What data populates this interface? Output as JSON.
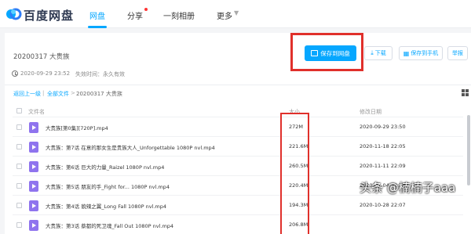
{
  "brand": {
    "name": "百度网盘"
  },
  "nav": {
    "items": [
      "网盘",
      "分享",
      "一刻相册",
      "更多"
    ]
  },
  "share": {
    "folder_title": "20200317 大贵族",
    "created": "2020-09-29 23:52",
    "expiry": "失效时间：永久有效"
  },
  "toolbar": {
    "save_label": "保存到网盘",
    "download_label": "下载",
    "save_phone_label": "保存到手机",
    "report_label": "举报"
  },
  "breadcrumb": {
    "back": "返回上一级",
    "sep": "|",
    "all_files": "全部文件",
    "arrow": ">",
    "current": "20200317 大贵族"
  },
  "table": {
    "headers": {
      "name": "文件名",
      "size": "大小",
      "date": "修改日期"
    },
    "rows": [
      {
        "name": "大贵族[第0集][720P].mp4",
        "size": "272M",
        "date": "2020-09-29 23:50"
      },
      {
        "name": "大贵族：第7话 在意的那女生是贵族大人_Unforgettable 1080P nvl.mp4",
        "size": "221.6M",
        "date": "2020-11-18 22:05"
      },
      {
        "name": "大贵族：第6话 巨大的力量_Raizel 1080P nvl.mp4",
        "size": "260.5M",
        "date": "2020-11-11 22:09"
      },
      {
        "name": "大贵族：第5话 朋友的手_Fight for...   1080P nvl.mp4",
        "size": "220.4M",
        "date": "2020-11-04 23:39"
      },
      {
        "name": "大贵族：第4话 貌辣之翼_Long Fall 1080P nvl.mp4",
        "size": "194.3M",
        "date": "2020-10-28 22:07"
      },
      {
        "name": "大贵族：第3话 蔡都的死卫魂_Fall Out 1080P nvl.mp4",
        "size": "206.8M",
        "date": ""
      }
    ]
  },
  "watermark": "头条 @楠楠子aaa",
  "colors": {
    "accent": "#06a7ff",
    "highlight": "#e0302b",
    "video_icon": "#8f74ee"
  },
  "icons": [
    "baidu-logo-icon",
    "save-icon",
    "download-icon",
    "phone-icon",
    "clock-icon",
    "grid-view-icon",
    "video-file-icon"
  ]
}
